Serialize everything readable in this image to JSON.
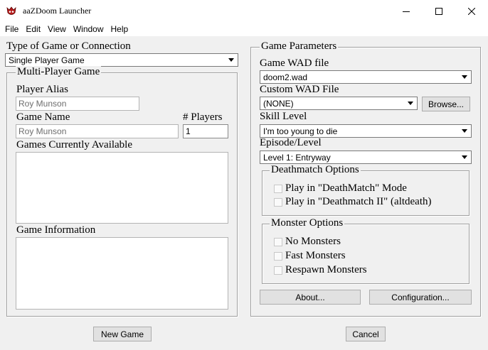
{
  "window": {
    "title": "aaZDoom Launcher"
  },
  "menu": [
    "File",
    "Edit",
    "View",
    "Window",
    "Help"
  ],
  "left": {
    "game_type_label": "Type of Game or Connection",
    "game_type_value": "Single Player Game",
    "multi_group_title": "Multi-Player Game",
    "player_alias_label": "Player Alias",
    "player_alias_value": "Roy Munson",
    "game_name_label": "Game Name",
    "game_name_value": "Roy Munson",
    "players_label": "# Players",
    "players_value": "1",
    "games_available_label": "Games Currently Available",
    "game_info_label": "Game Information"
  },
  "right": {
    "group_title": "Game Parameters",
    "wad_label": "Game WAD file",
    "wad_value": "doom2.wad",
    "custom_wad_label": "Custom WAD File",
    "custom_wad_value": "(NONE)",
    "browse_label": "Browse...",
    "skill_label": "Skill Level",
    "skill_value": "I'm too young to die",
    "episode_label": "Episode/Level",
    "episode_value": "Level 1: Entryway",
    "deathmatch_title": "Deathmatch Options",
    "deathmatch_options": [
      "Play in \"DeathMatch\" Mode",
      "Play in \"Deathmatch II\" (altdeath)"
    ],
    "monster_title": "Monster Options",
    "monster_options": [
      "No Monsters",
      "Fast Monsters",
      "Respawn Monsters"
    ],
    "about_label": "About...",
    "config_label": "Configuration..."
  },
  "bottom": {
    "new_game_label": "New Game",
    "cancel_label": "Cancel"
  },
  "colors": {
    "window_bg": "#f0f0f0",
    "titlebar_bg": "#ffffff",
    "button_bg": "#e1e1e1"
  },
  "icons": {
    "app": "doom-skull-icon",
    "minimize": "minimize-icon",
    "maximize": "maximize-icon",
    "close": "close-icon"
  }
}
